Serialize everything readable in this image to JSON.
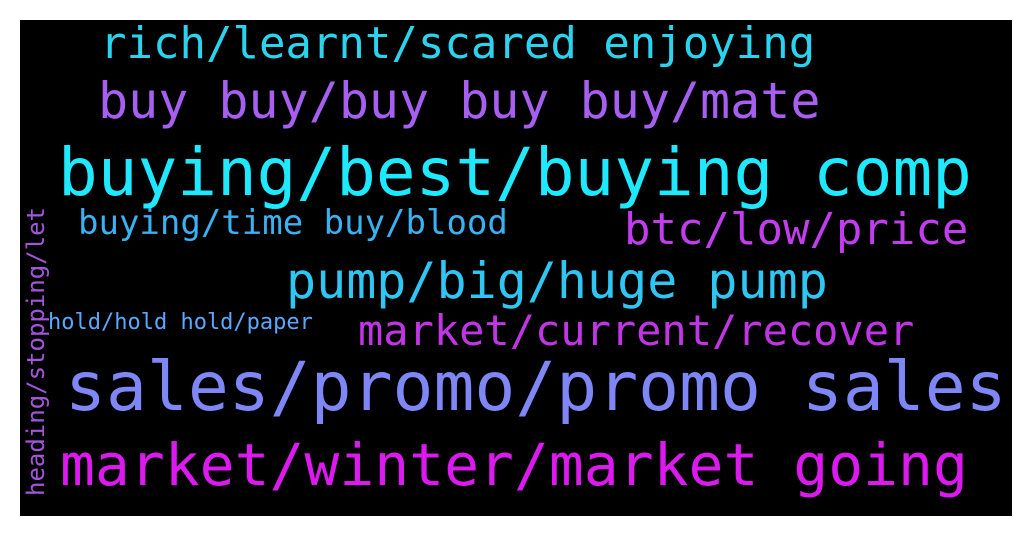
{
  "cloud": {
    "words": [
      {
        "text": "rich/learnt/scared enjoying",
        "color": "#2ad4ee"
      },
      {
        "text": "buy buy/buy buy buy/mate",
        "color": "#a65ff0"
      },
      {
        "text": "buying/best/buying comp",
        "color": "#1fe9ff"
      },
      {
        "text": "buying/time buy/blood",
        "color": "#38b2f2"
      },
      {
        "text": "btc/low/price",
        "color": "#c23ded"
      },
      {
        "text": "pump/big/huge pump",
        "color": "#2fc6f4"
      },
      {
        "text": "hold/hold hold/paper",
        "color": "#5aa8ff"
      },
      {
        "text": "market/current/recover",
        "color": "#c036e4"
      },
      {
        "text": "sales/promo/promo sales",
        "color": "#7f86f6"
      },
      {
        "text": "market/winter/market going",
        "color": "#dc1aef"
      },
      {
        "text": "heading/stopping/let",
        "color": "#a356dd"
      }
    ]
  }
}
